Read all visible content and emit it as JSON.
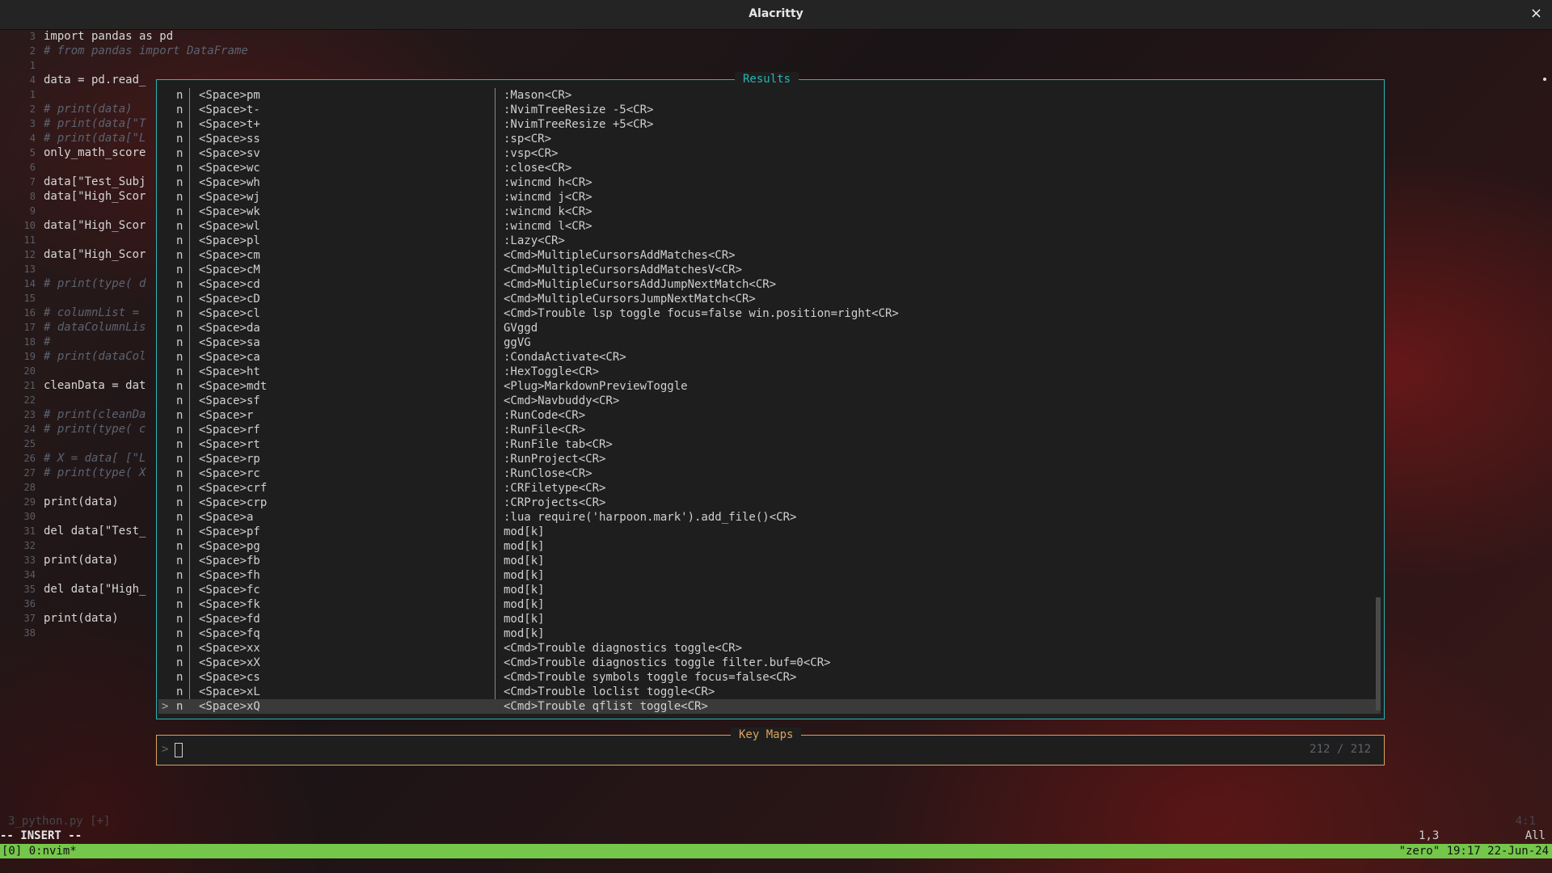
{
  "window": {
    "title": "Alacritty",
    "close_glyph": "×"
  },
  "editor": {
    "lines": [
      {
        "n": "3",
        "t": "import pandas as pd",
        "c": false
      },
      {
        "n": "2",
        "t": "# from pandas import DataFrame",
        "c": true
      },
      {
        "n": "1",
        "t": "",
        "c": false
      },
      {
        "n": "4",
        "t": "data = pd.read_",
        "c": false
      },
      {
        "n": "1",
        "t": "",
        "c": false
      },
      {
        "n": "2",
        "t": "# print(data)",
        "c": true
      },
      {
        "n": "3",
        "t": "# print(data[\"T",
        "c": true
      },
      {
        "n": "4",
        "t": "# print(data[\"L",
        "c": true
      },
      {
        "n": "5",
        "t": "only_math_score",
        "c": false
      },
      {
        "n": "6",
        "t": "",
        "c": false
      },
      {
        "n": "7",
        "t": "data[\"Test_Subj",
        "c": false
      },
      {
        "n": "8",
        "t": "data[\"High_Scor",
        "c": false
      },
      {
        "n": "9",
        "t": "",
        "c": false
      },
      {
        "n": "10",
        "t": "data[\"High_Scor",
        "c": false
      },
      {
        "n": "11",
        "t": "",
        "c": false
      },
      {
        "n": "12",
        "t": "data[\"High_Scor",
        "c": false
      },
      {
        "n": "13",
        "t": "",
        "c": false
      },
      {
        "n": "14",
        "t": "# print(type( d",
        "c": true
      },
      {
        "n": "15",
        "t": "",
        "c": false
      },
      {
        "n": "16",
        "t": "# columnList =",
        "c": true
      },
      {
        "n": "17",
        "t": "# dataColumnLis",
        "c": true
      },
      {
        "n": "18",
        "t": "#",
        "c": true
      },
      {
        "n": "19",
        "t": "# print(dataCol",
        "c": true
      },
      {
        "n": "20",
        "t": "",
        "c": false
      },
      {
        "n": "21",
        "t": "cleanData = dat",
        "c": false
      },
      {
        "n": "22",
        "t": "",
        "c": false
      },
      {
        "n": "23",
        "t": "# print(cleanDa",
        "c": true
      },
      {
        "n": "24",
        "t": "# print(type( c",
        "c": true
      },
      {
        "n": "25",
        "t": "",
        "c": false
      },
      {
        "n": "26",
        "t": "# X = data[ [\"L",
        "c": true
      },
      {
        "n": "27",
        "t": "# print(type( X",
        "c": true
      },
      {
        "n": "28",
        "t": "",
        "c": false
      },
      {
        "n": "29",
        "t": "print(data)",
        "c": false
      },
      {
        "n": "30",
        "t": "",
        "c": false
      },
      {
        "n": "31",
        "t": "del data[\"Test_",
        "c": false
      },
      {
        "n": "32",
        "t": "",
        "c": false
      },
      {
        "n": "33",
        "t": "print(data)",
        "c": false
      },
      {
        "n": "34",
        "t": "",
        "c": false
      },
      {
        "n": "35",
        "t": "del data[\"High_",
        "c": false
      },
      {
        "n": "36",
        "t": "",
        "c": false
      },
      {
        "n": "37",
        "t": "print(data)",
        "c": false
      },
      {
        "n": "38",
        "t": "",
        "c": false
      }
    ]
  },
  "results": {
    "title": "Results",
    "selected_marker": ">",
    "rows": [
      {
        "mode": "n",
        "lhs": "<Space>pm",
        "rhs": ":Mason<CR>"
      },
      {
        "mode": "n",
        "lhs": "<Space>t-",
        "rhs": ":NvimTreeResize -5<CR>"
      },
      {
        "mode": "n",
        "lhs": "<Space>t+",
        "rhs": ":NvimTreeResize +5<CR>"
      },
      {
        "mode": "n",
        "lhs": "<Space>ss",
        "rhs": ":sp<CR>"
      },
      {
        "mode": "n",
        "lhs": "<Space>sv",
        "rhs": ":vsp<CR>"
      },
      {
        "mode": "n",
        "lhs": "<Space>wc",
        "rhs": ":close<CR>"
      },
      {
        "mode": "n",
        "lhs": "<Space>wh",
        "rhs": ":wincmd h<CR>"
      },
      {
        "mode": "n",
        "lhs": "<Space>wj",
        "rhs": ":wincmd j<CR>"
      },
      {
        "mode": "n",
        "lhs": "<Space>wk",
        "rhs": ":wincmd k<CR>"
      },
      {
        "mode": "n",
        "lhs": "<Space>wl",
        "rhs": ":wincmd l<CR>"
      },
      {
        "mode": "n",
        "lhs": "<Space>pl",
        "rhs": ":Lazy<CR>"
      },
      {
        "mode": "n",
        "lhs": "<Space>cm",
        "rhs": "<Cmd>MultipleCursorsAddMatches<CR>"
      },
      {
        "mode": "n",
        "lhs": "<Space>cM",
        "rhs": "<Cmd>MultipleCursorsAddMatchesV<CR>"
      },
      {
        "mode": "n",
        "lhs": "<Space>cd",
        "rhs": "<Cmd>MultipleCursorsAddJumpNextMatch<CR>"
      },
      {
        "mode": "n",
        "lhs": "<Space>cD",
        "rhs": "<Cmd>MultipleCursorsJumpNextMatch<CR>"
      },
      {
        "mode": "n",
        "lhs": "<Space>cl",
        "rhs": "<Cmd>Trouble lsp toggle focus=false win.position=right<CR>"
      },
      {
        "mode": "n",
        "lhs": "<Space>da",
        "rhs": "GVggd"
      },
      {
        "mode": "n",
        "lhs": "<Space>sa",
        "rhs": "ggVG"
      },
      {
        "mode": "n",
        "lhs": "<Space>ca",
        "rhs": ":CondaActivate<CR>"
      },
      {
        "mode": "n",
        "lhs": "<Space>ht",
        "rhs": ":HexToggle<CR>"
      },
      {
        "mode": "n",
        "lhs": "<Space>mdt",
        "rhs": "<Plug>MarkdownPreviewToggle"
      },
      {
        "mode": "n",
        "lhs": "<Space>sf",
        "rhs": "<Cmd>Navbuddy<CR>"
      },
      {
        "mode": "n",
        "lhs": "<Space>r",
        "rhs": ":RunCode<CR>"
      },
      {
        "mode": "n",
        "lhs": "<Space>rf",
        "rhs": ":RunFile<CR>"
      },
      {
        "mode": "n",
        "lhs": "<Space>rt",
        "rhs": ":RunFile tab<CR>"
      },
      {
        "mode": "n",
        "lhs": "<Space>rp",
        "rhs": ":RunProject<CR>"
      },
      {
        "mode": "n",
        "lhs": "<Space>rc",
        "rhs": ":RunClose<CR>"
      },
      {
        "mode": "n",
        "lhs": "<Space>crf",
        "rhs": ":CRFiletype<CR>"
      },
      {
        "mode": "n",
        "lhs": "<Space>crp",
        "rhs": ":CRProjects<CR>"
      },
      {
        "mode": "n",
        "lhs": "<Space>a",
        "rhs": ":lua require('harpoon.mark').add_file()<CR>"
      },
      {
        "mode": "n",
        "lhs": "<Space>pf",
        "rhs": "mod[k]"
      },
      {
        "mode": "n",
        "lhs": "<Space>pg",
        "rhs": "mod[k]"
      },
      {
        "mode": "n",
        "lhs": "<Space>fb",
        "rhs": "mod[k]"
      },
      {
        "mode": "n",
        "lhs": "<Space>fh",
        "rhs": "mod[k]"
      },
      {
        "mode": "n",
        "lhs": "<Space>fc",
        "rhs": "mod[k]"
      },
      {
        "mode": "n",
        "lhs": "<Space>fk",
        "rhs": "mod[k]"
      },
      {
        "mode": "n",
        "lhs": "<Space>fd",
        "rhs": "mod[k]"
      },
      {
        "mode": "n",
        "lhs": "<Space>fq",
        "rhs": "mod[k]"
      },
      {
        "mode": "n",
        "lhs": "<Space>xx",
        "rhs": "<Cmd>Trouble diagnostics toggle<CR>"
      },
      {
        "mode": "n",
        "lhs": "<Space>xX",
        "rhs": "<Cmd>Trouble diagnostics toggle filter.buf=0<CR>"
      },
      {
        "mode": "n",
        "lhs": "<Space>cs",
        "rhs": "<Cmd>Trouble symbols toggle focus=false<CR>"
      },
      {
        "mode": "n",
        "lhs": "<Space>xL",
        "rhs": "<Cmd>Trouble loclist toggle<CR>"
      },
      {
        "mode": "n",
        "lhs": "<Space>xQ",
        "rhs": "<Cmd>Trouble qflist toggle<CR>",
        "selected": true
      }
    ]
  },
  "prompt": {
    "title": "Key Maps",
    "caret": ">",
    "count": "212 / 212"
  },
  "statusline": {
    "filename": "3_python.py [+]",
    "right_pos": "4:1",
    "mode": "-- INSERT --",
    "cursor": "1,3",
    "scroll": "All"
  },
  "tmux": {
    "left": "[0] 0:nvim*",
    "right": "\"zero\" 19:17 22-Jun-24"
  },
  "colors": {
    "results_border": "#2bb4b4",
    "prompt_border": "#d9a35e",
    "tmux_bar": "#74c74a"
  }
}
